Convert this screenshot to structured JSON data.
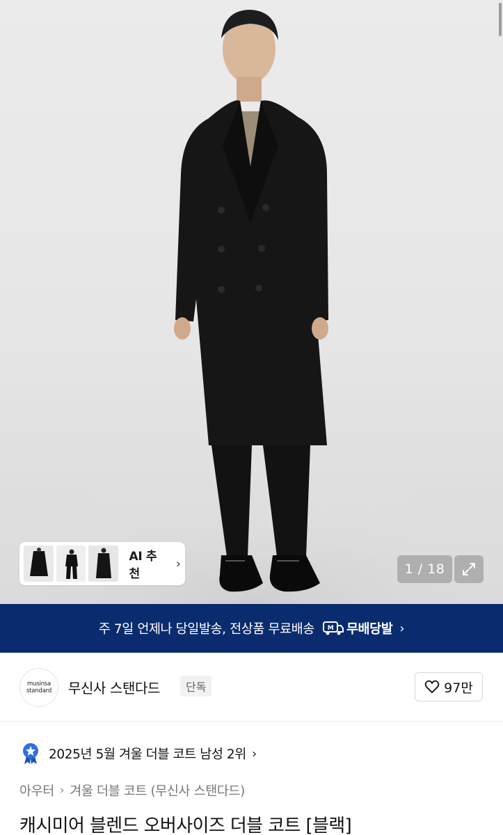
{
  "gallery": {
    "counter_current": "1",
    "counter_sep": " / ",
    "counter_total": "18",
    "ai_label": "AI 추천",
    "ai_chevron": "›",
    "expand_icon": "expand-icon"
  },
  "banner": {
    "text": "주 7일 언제나 당일발송, 전상품 무료배송",
    "badge_label": "무배당발",
    "chevron": "›",
    "background": "#0a2c6e"
  },
  "brand": {
    "logo_line1": "musinsa",
    "logo_line2": "standard",
    "name": "무신사 스탠다드",
    "exclusive_badge": "단독",
    "likes": "97만"
  },
  "ranking": {
    "text": "2025년 5월 겨울 더블 코트 남성 2위",
    "chevron": "›",
    "icon_color": "#2f6fe4"
  },
  "breadcrumb": {
    "items": [
      "아우터",
      "겨울 더블 코트 (무신사 스탠다드)"
    ],
    "separator": "›"
  },
  "product": {
    "title": "캐시미어 블렌드 오버사이즈 더블 코트 [블랙]"
  }
}
